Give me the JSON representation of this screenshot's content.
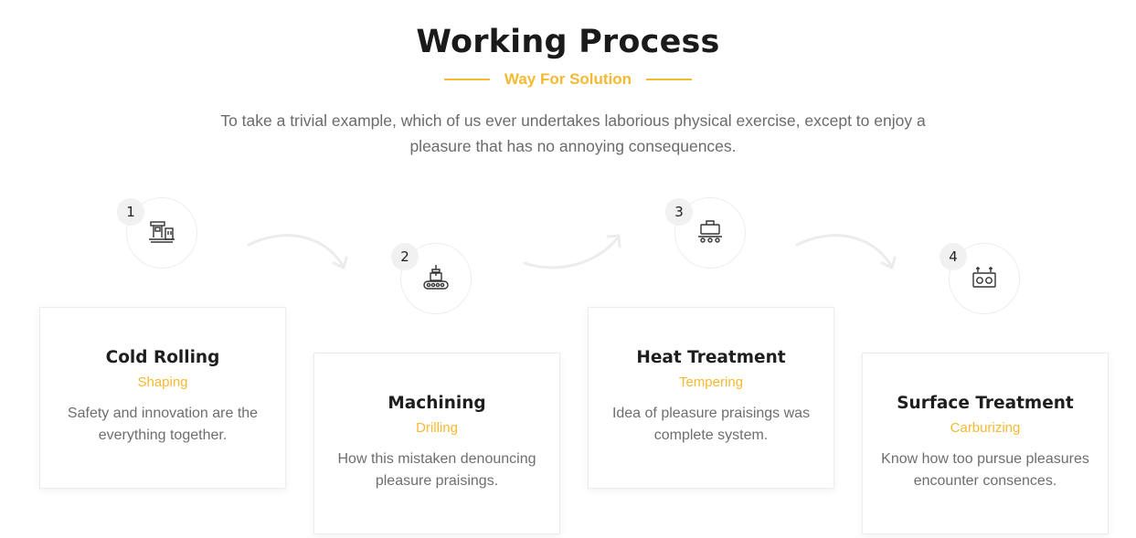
{
  "header": {
    "title": "Working Process",
    "subtitle": "Way For Solution",
    "intro": "To take a trivial example, which of us ever undertakes laborious physical exercise, except to enjoy a pleasure that has no annoying consequences."
  },
  "colors": {
    "accent": "#f5b932",
    "text_muted": "#6e6e6e",
    "heading": "#1e1e1e"
  },
  "steps": [
    {
      "number": "1",
      "icon": "rolling-mill-icon",
      "title": "Cold Rolling",
      "subtitle": "Shaping",
      "description": "Safety and innovation are the everything together."
    },
    {
      "number": "2",
      "icon": "conveyor-machining-icon",
      "title": "Machining",
      "subtitle": "Drilling",
      "description": "How this mistaken denouncing pleasure praisings."
    },
    {
      "number": "3",
      "icon": "furnace-conveyor-icon",
      "title": "Heat Treatment",
      "subtitle": "Tempering",
      "description": "Idea of pleasure praisings was complete system."
    },
    {
      "number": "4",
      "icon": "surface-machine-icon",
      "title": "Surface Treatment",
      "subtitle": "Carburizing",
      "description": "Know how too pursue pleasures encounter consences."
    }
  ]
}
